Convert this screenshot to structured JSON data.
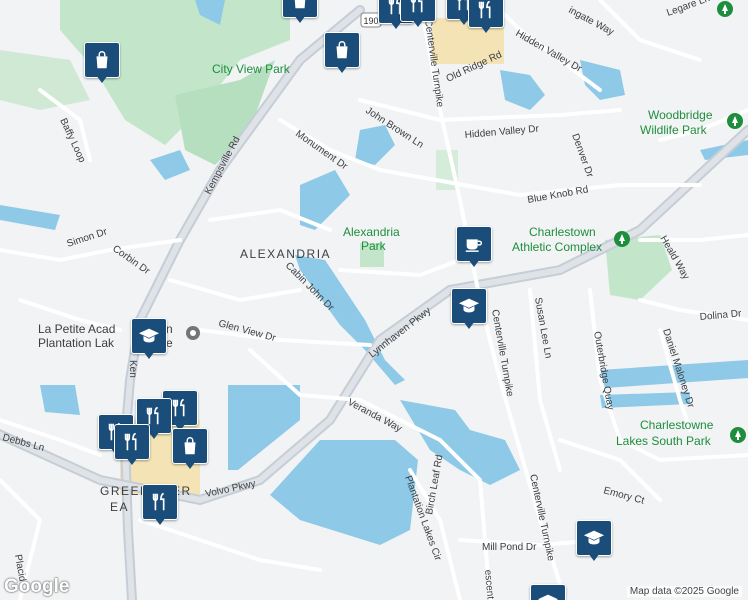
{
  "map": {
    "attribution": "Map data ©2025 Google",
    "logo": "Google",
    "colors": {
      "water": "#8ec9e8",
      "park": "#c3e6cb",
      "road": "#ffffff",
      "highway": "#c5cdd6",
      "pin": "#1a4d7a",
      "school_area": "#f3e3b5"
    },
    "area_labels": {
      "alexandria": "ALEXANDRIA",
      "greenbrier_1": "GREEN",
      "greenbrier_2": "ER",
      "greenbrier_3": "EA"
    },
    "parks": {
      "city_view": "City View Park",
      "alexandria_1": "Alexandria",
      "alexandria_2": "Park",
      "charlestown_1": "Charlestown",
      "charlestown_2": "Athletic Complex",
      "woodbridge_1": "Woodbridge",
      "woodbridge_2": "Wildlife Park",
      "charlestowne_1": "Charlestowne",
      "charlestowne_2": "Lakes South Park"
    },
    "pois": {
      "petite_1": "La Petite Acad",
      "petite_1b": "n",
      "petite_2": "Plantation Lak",
      "petite_2b": "e"
    },
    "roads": {
      "baffy": "Baffy Loop",
      "kempsville": "Kempsville Rd",
      "kempsville_short": "Ken",
      "monument": "Monument Dr",
      "john_brown": "John Brown Ln",
      "centerville": "Centerville Turnpike",
      "old_ridge": "Old Ridge Rd",
      "hidden_valley": "Hidden Valley Dr",
      "hidden_valley_2": "Hidden Valley Dr",
      "legare": "Legare Ln",
      "ingate": "ingate Way",
      "denver": "Denver Dr",
      "blue_knob": "Blue Knob Rd",
      "simon": "Simon Dr",
      "corbin": "Corbin Dr",
      "cabin_john": "Cabin John Dr",
      "glen_view": "Glen View Dr",
      "lynnhaven": "Lynnhaven Pkwy",
      "susan_lee": "Susan Lee Ln",
      "outerbridge": "Outerbridge Quay",
      "daniel_maloney": "Daniel Maloney Dr",
      "dolina": "Dolina Dr",
      "heald": "Heald Way",
      "veranda": "Veranda Way",
      "debbs": "Debbs Ln",
      "volvo": "Volvo Pkwy",
      "plantation_lakes": "Plantation Lakes Cir",
      "birch_leaf": "Birch Leaf Rd",
      "mill_pond": "Mill Pond Dr",
      "emory": "Emory Ct",
      "crescent": "escent",
      "placid": "Placid",
      "route": "190"
    },
    "markers": [
      {
        "icon": "shopping-bag-icon"
      },
      {
        "icon": "shopping-bag-icon"
      },
      {
        "icon": "restaurant-icon"
      },
      {
        "icon": "restaurant-icon"
      },
      {
        "icon": "restaurant-icon"
      },
      {
        "icon": "shopping-bag-icon"
      },
      {
        "icon": "cafe-icon"
      },
      {
        "icon": "school-icon"
      },
      {
        "icon": "school-icon"
      },
      {
        "icon": "restaurant-icon"
      },
      {
        "icon": "restaurant-icon"
      },
      {
        "icon": "restaurant-icon"
      },
      {
        "icon": "restaurant-icon"
      },
      {
        "icon": "shopping-bag-icon"
      },
      {
        "icon": "restaurant-icon"
      },
      {
        "icon": "school-icon"
      },
      {
        "icon": "school-icon"
      }
    ]
  }
}
